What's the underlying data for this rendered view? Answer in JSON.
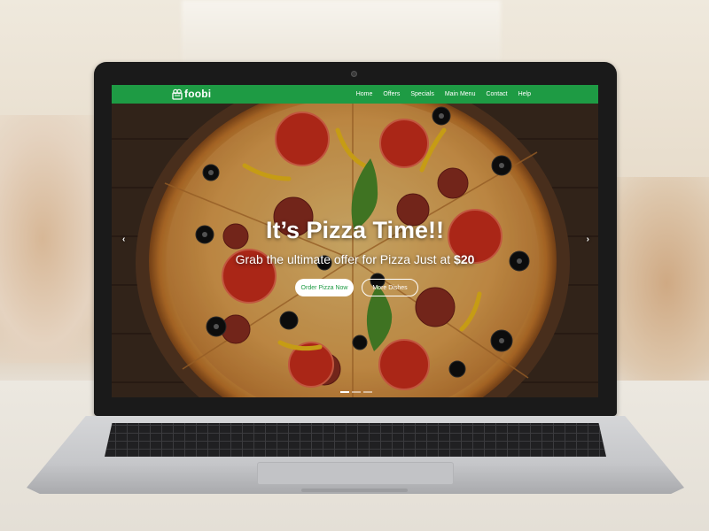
{
  "brand": {
    "name": "foobi",
    "color": "#1e9b44"
  },
  "nav": {
    "items": [
      {
        "label": "Home"
      },
      {
        "label": "Offers"
      },
      {
        "label": "Specials"
      },
      {
        "label": "Main Menu"
      },
      {
        "label": "Contact"
      },
      {
        "label": "Help"
      }
    ]
  },
  "hero": {
    "title": "It’s Pizza Time!!",
    "subtitle": "Grab the ultimate offer for Pizza Just at",
    "price": "$20",
    "primary_button": "Order Pizza Now",
    "secondary_button": "More Dishes",
    "prev_icon": "chevron-left-icon",
    "next_icon": "chevron-right-icon",
    "slide_count": 3,
    "active_slide": 1
  }
}
